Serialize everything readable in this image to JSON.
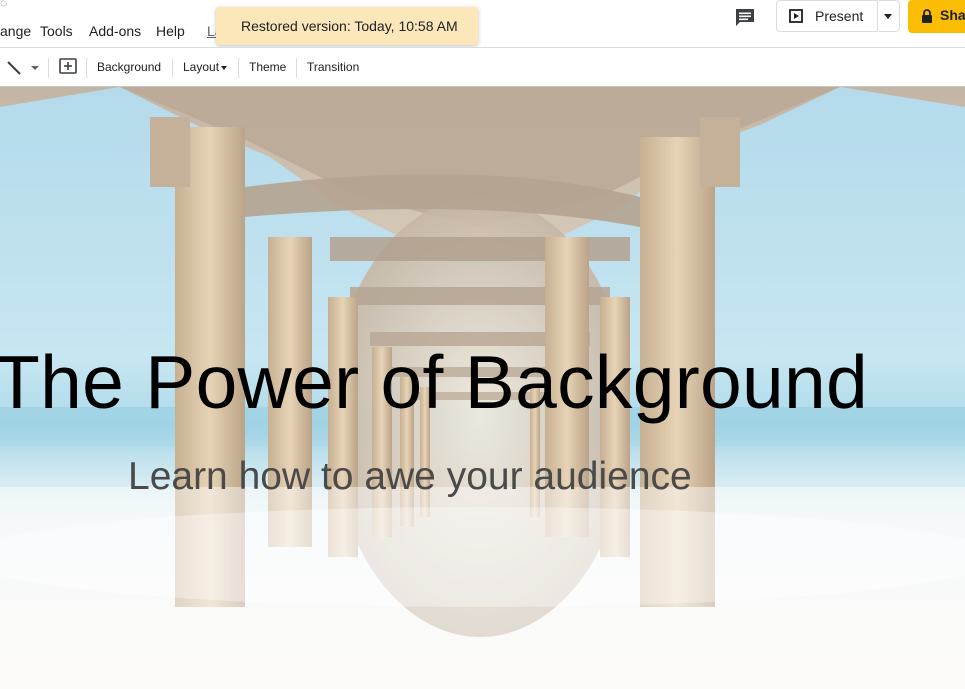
{
  "menu": {
    "items": [
      "ange",
      "Tools",
      "Add-ons",
      "Help"
    ],
    "last_edit_label": "La"
  },
  "toast": {
    "text": "Restored version: Today, 10:58 AM"
  },
  "header": {
    "present_label": "Present",
    "share_label": "Sha"
  },
  "toolbar": {
    "background_label": "Background",
    "layout_label": "Layout",
    "theme_label": "Theme",
    "transition_label": "Transition"
  },
  "slide": {
    "title": "The Power of Background",
    "subtitle": "Learn how to awe your audience"
  },
  "icons": {
    "comment": "comment-icon",
    "present": "play-icon",
    "lock": "lock-icon",
    "line_tool": "line-tool-icon",
    "new_slide": "add-box-icon"
  },
  "colors": {
    "share_button": "#fbbc04",
    "toast_bg": "#fbe7b9",
    "border": "#dadce0"
  }
}
